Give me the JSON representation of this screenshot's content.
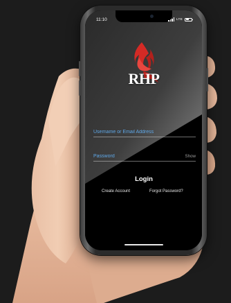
{
  "status_bar": {
    "time": "11:10",
    "network": "LTE"
  },
  "brand": {
    "logo_text": "RHP",
    "accent_color": "#d42a25"
  },
  "form": {
    "username_placeholder": "Username or Email Address",
    "password_placeholder": "Password",
    "show_label": "Show",
    "input_color": "#5fa8e8"
  },
  "actions": {
    "login_label": "Login",
    "create_account_label": "Create Account",
    "forgot_password_label": "Forgot Password?"
  }
}
